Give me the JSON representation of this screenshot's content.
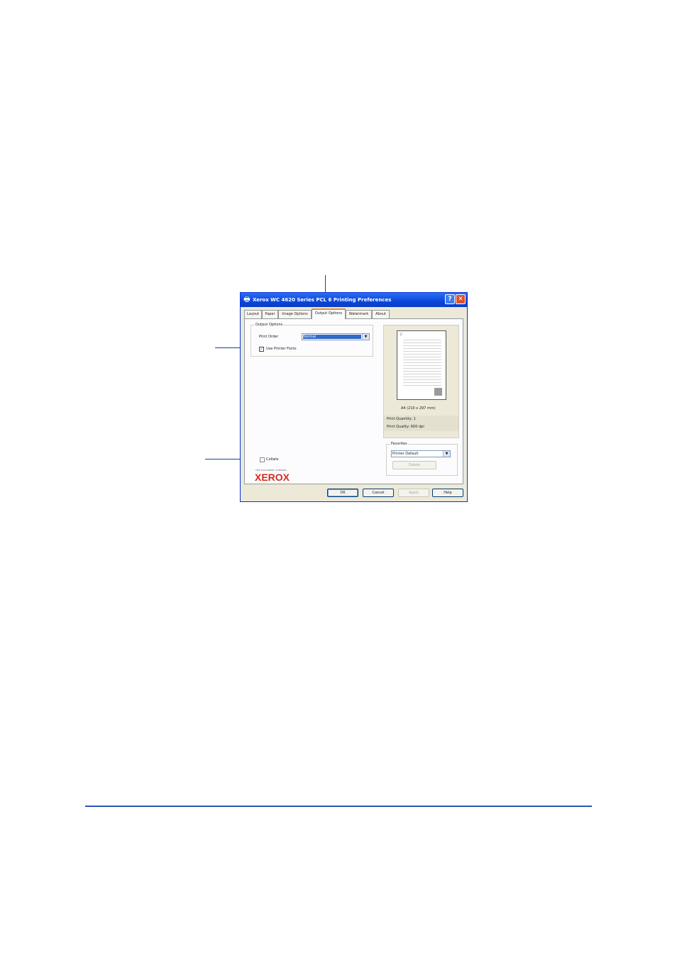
{
  "dialog": {
    "title": "Xerox WC 4620 Series PCL 6 Printing Preferences",
    "title_icon": "printer-icon",
    "help_label": "?",
    "close_label": "✕",
    "tabs": [
      {
        "label": "Layout"
      },
      {
        "label": "Paper"
      },
      {
        "label": "Image Options"
      },
      {
        "label": "Output Options",
        "active": true
      },
      {
        "label": "Watermark"
      },
      {
        "label": "About"
      }
    ],
    "output_options": {
      "group_label": "Output Options",
      "print_order_label": "Print Order",
      "print_order_value": "Normal",
      "use_printer_fonts_label": "Use Printer Fonts",
      "use_printer_fonts_checked": true
    },
    "collate_label": "Collate",
    "collate_checked": false,
    "preview": {
      "page_letter": "F",
      "paper_size": "A4 (210 x 297 mm)",
      "print_quantity": "Print Quantity: 1",
      "print_quality": "Print Quality: 600 dpi"
    },
    "favorites": {
      "group_label": "Favorites",
      "value": "Printer Default",
      "delete_label": "Delete"
    },
    "buttons": {
      "ok": "OK",
      "cancel": "Cancel",
      "apply": "Apply",
      "help": "Help"
    },
    "brand": {
      "tagline": "THE DOCUMENT COMPANY",
      "logo": "XEROX",
      "logo_color": "#d52b1e"
    },
    "accent_color": "#0a46d8"
  }
}
